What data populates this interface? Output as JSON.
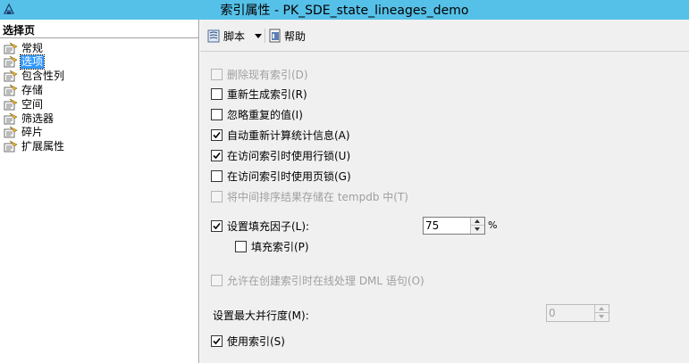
{
  "window": {
    "title": "索引属性 - PK_SDE_state_lineages_demo",
    "icon": "sql-management-studio-icon"
  },
  "sidebar": {
    "header": "选择页",
    "items": [
      {
        "label": "常规",
        "icon": "page-icon",
        "selected": false
      },
      {
        "label": "选项",
        "icon": "page-icon",
        "selected": true
      },
      {
        "label": "包含性列",
        "icon": "page-icon",
        "selected": false
      },
      {
        "label": "存储",
        "icon": "page-icon",
        "selected": false
      },
      {
        "label": "空间",
        "icon": "page-icon",
        "selected": false
      },
      {
        "label": "筛选器",
        "icon": "page-icon",
        "selected": false
      },
      {
        "label": "碎片",
        "icon": "page-icon",
        "selected": false
      },
      {
        "label": "扩展属性",
        "icon": "page-icon",
        "selected": false
      }
    ]
  },
  "toolbar": {
    "script_label": "脚本",
    "script_icon": "script-icon",
    "dropdown_icon": "chevron-down-icon",
    "help_label": "帮助",
    "help_icon": "help-icon"
  },
  "options": [
    {
      "label": "删除现有索引(D)",
      "checked": false,
      "disabled": true
    },
    {
      "label": "重新生成索引(R)",
      "checked": false,
      "disabled": false
    },
    {
      "label": "忽略重复的值(I)",
      "checked": false,
      "disabled": false
    },
    {
      "label": "自动重新计算统计信息(A)",
      "checked": true,
      "disabled": false
    },
    {
      "label": "在访问索引时使用行锁(U)",
      "checked": true,
      "disabled": false
    },
    {
      "label": "在访问索引时使用页锁(G)",
      "checked": false,
      "disabled": false
    },
    {
      "label": "将中间排序结果存储在 tempdb 中(T)",
      "checked": false,
      "disabled": true
    },
    {
      "label": "设置填充因子(L):",
      "checked": true,
      "disabled": false
    },
    {
      "label": "填充索引(P)",
      "checked": false,
      "disabled": false
    },
    {
      "label": "允许在创建索引时在线处理 DML 语句(O)",
      "checked": false,
      "disabled": true
    },
    {
      "label": "使用索引(S)",
      "checked": true,
      "disabled": false
    }
  ],
  "fill_factor": {
    "value": "75",
    "unit": "%"
  },
  "max_dop": {
    "label": "设置最大并行度(M):",
    "value": "0",
    "disabled": true
  }
}
